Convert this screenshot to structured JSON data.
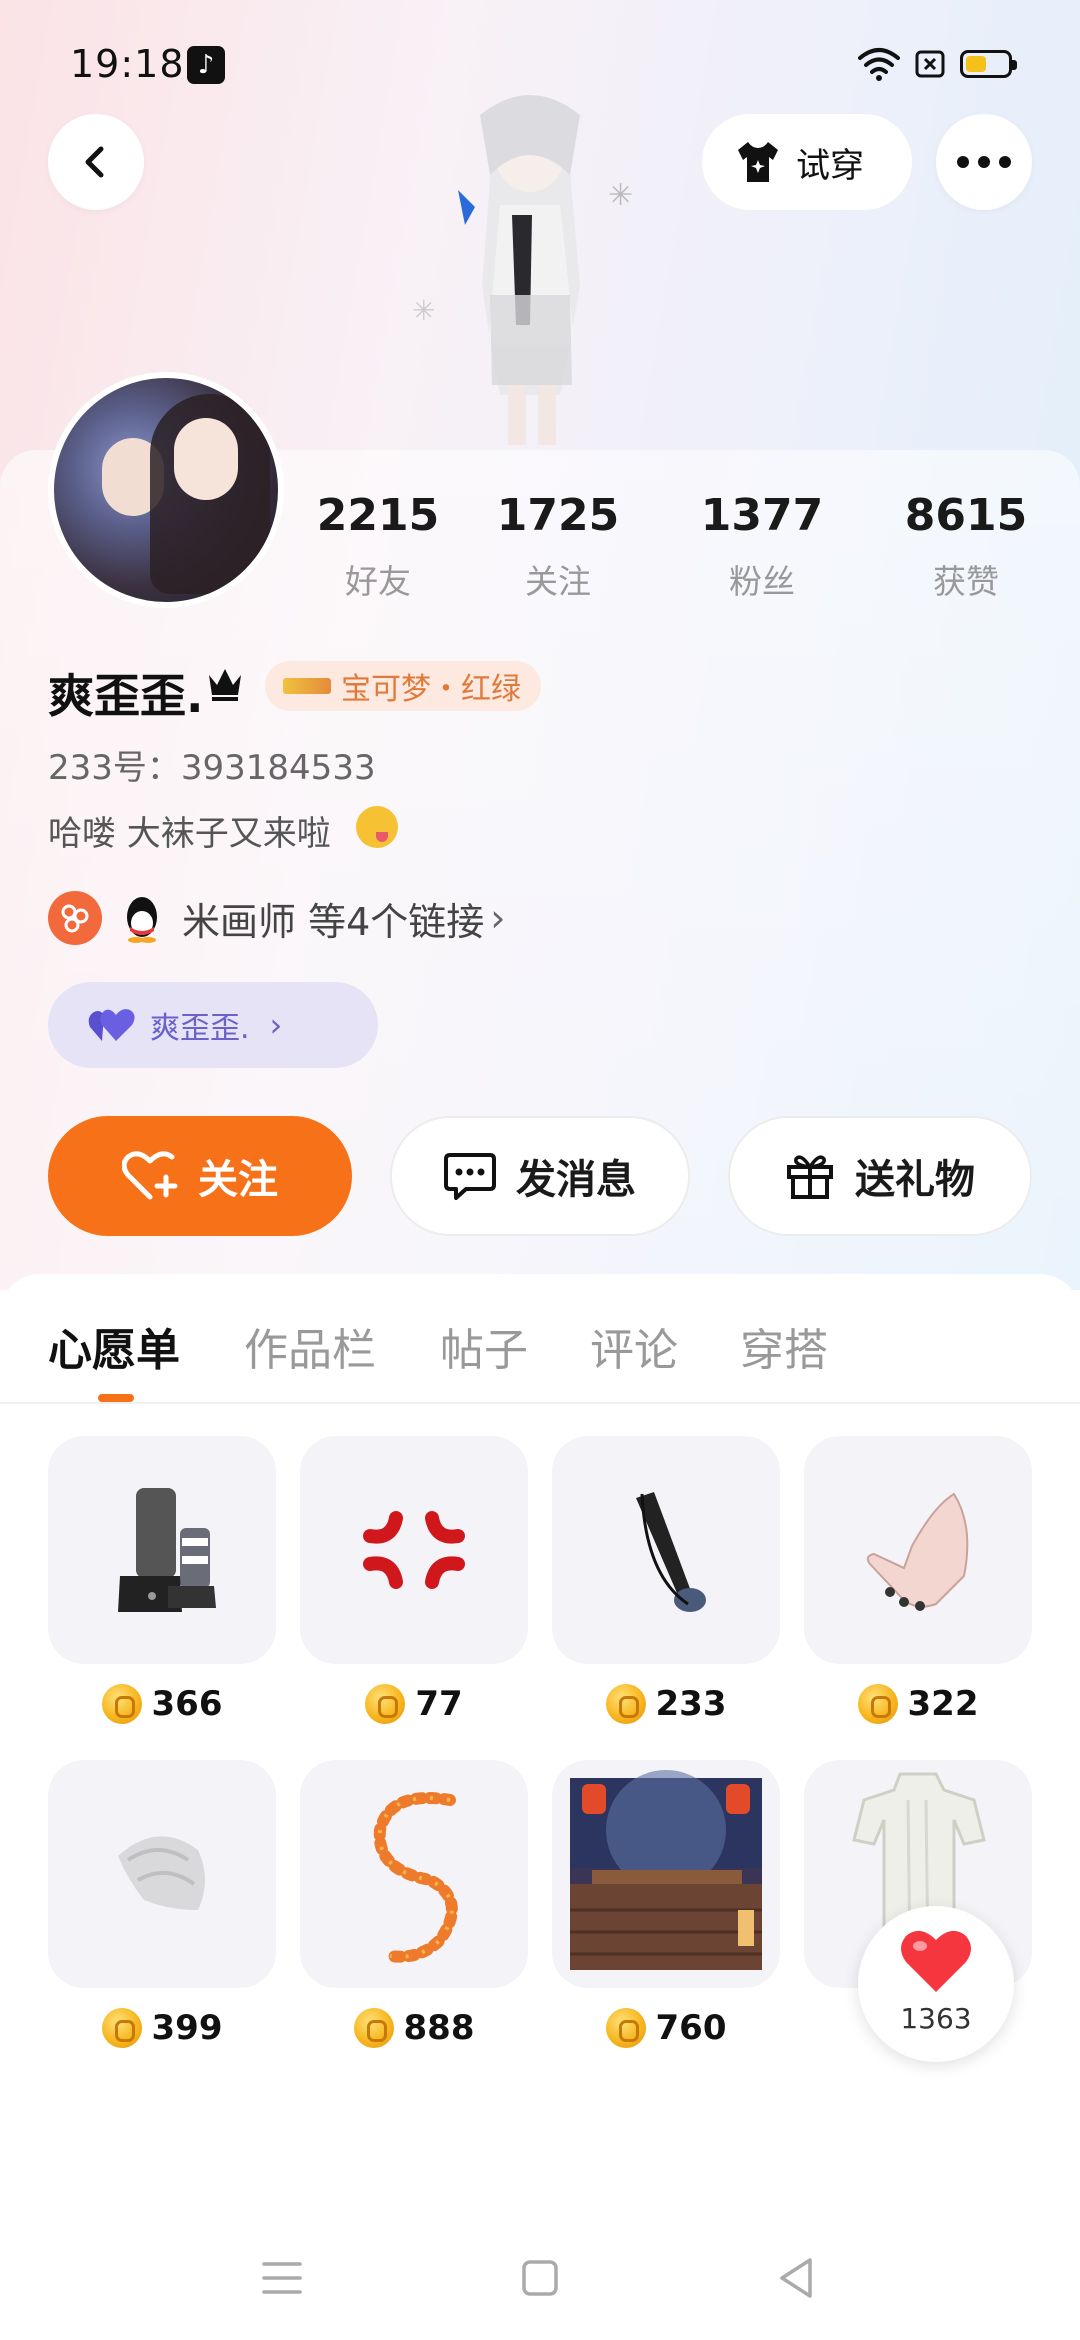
{
  "status": {
    "time": "19:18",
    "battery_level": 0.5,
    "battery_color": "#f4c21a"
  },
  "header": {
    "try_on_label": "试穿"
  },
  "profile": {
    "stats": [
      {
        "value": "2215",
        "label": "好友"
      },
      {
        "value": "1725",
        "label": "关注"
      },
      {
        "value": "1377",
        "label": "粉丝"
      },
      {
        "value": "8615",
        "label": "获赞"
      }
    ],
    "nickname": "爽歪歪.",
    "tag": "宝可梦・红绿",
    "uid": "233号：393184533",
    "bio": "哈喽 大袜子又来啦",
    "links_text": "米画师 等4个链接",
    "family_label": "爽歪歪."
  },
  "actions": {
    "follow_label": "关注",
    "message_label": "发消息",
    "gift_label": "送礼物"
  },
  "tabs": [
    "心愿单",
    "作品栏",
    "帖子",
    "评论",
    "穿搭"
  ],
  "active_tab": 0,
  "wishlist": [
    {
      "item": "boots-icon",
      "price": "366"
    },
    {
      "item": "anger-mark-icon",
      "price": "77"
    },
    {
      "item": "guitar-icon",
      "price": "233"
    },
    {
      "item": "hand-icon",
      "price": "322"
    },
    {
      "item": "fur-icon",
      "price": "399"
    },
    {
      "item": "leaf-trail-icon",
      "price": "888"
    },
    {
      "item": "scene-image",
      "price": "760"
    },
    {
      "item": "dress-icon",
      "price": ""
    }
  ],
  "like_count": "1363",
  "colors": {
    "accent": "#f77119",
    "family": "#6a62c8",
    "tag": "#e07a3a"
  }
}
